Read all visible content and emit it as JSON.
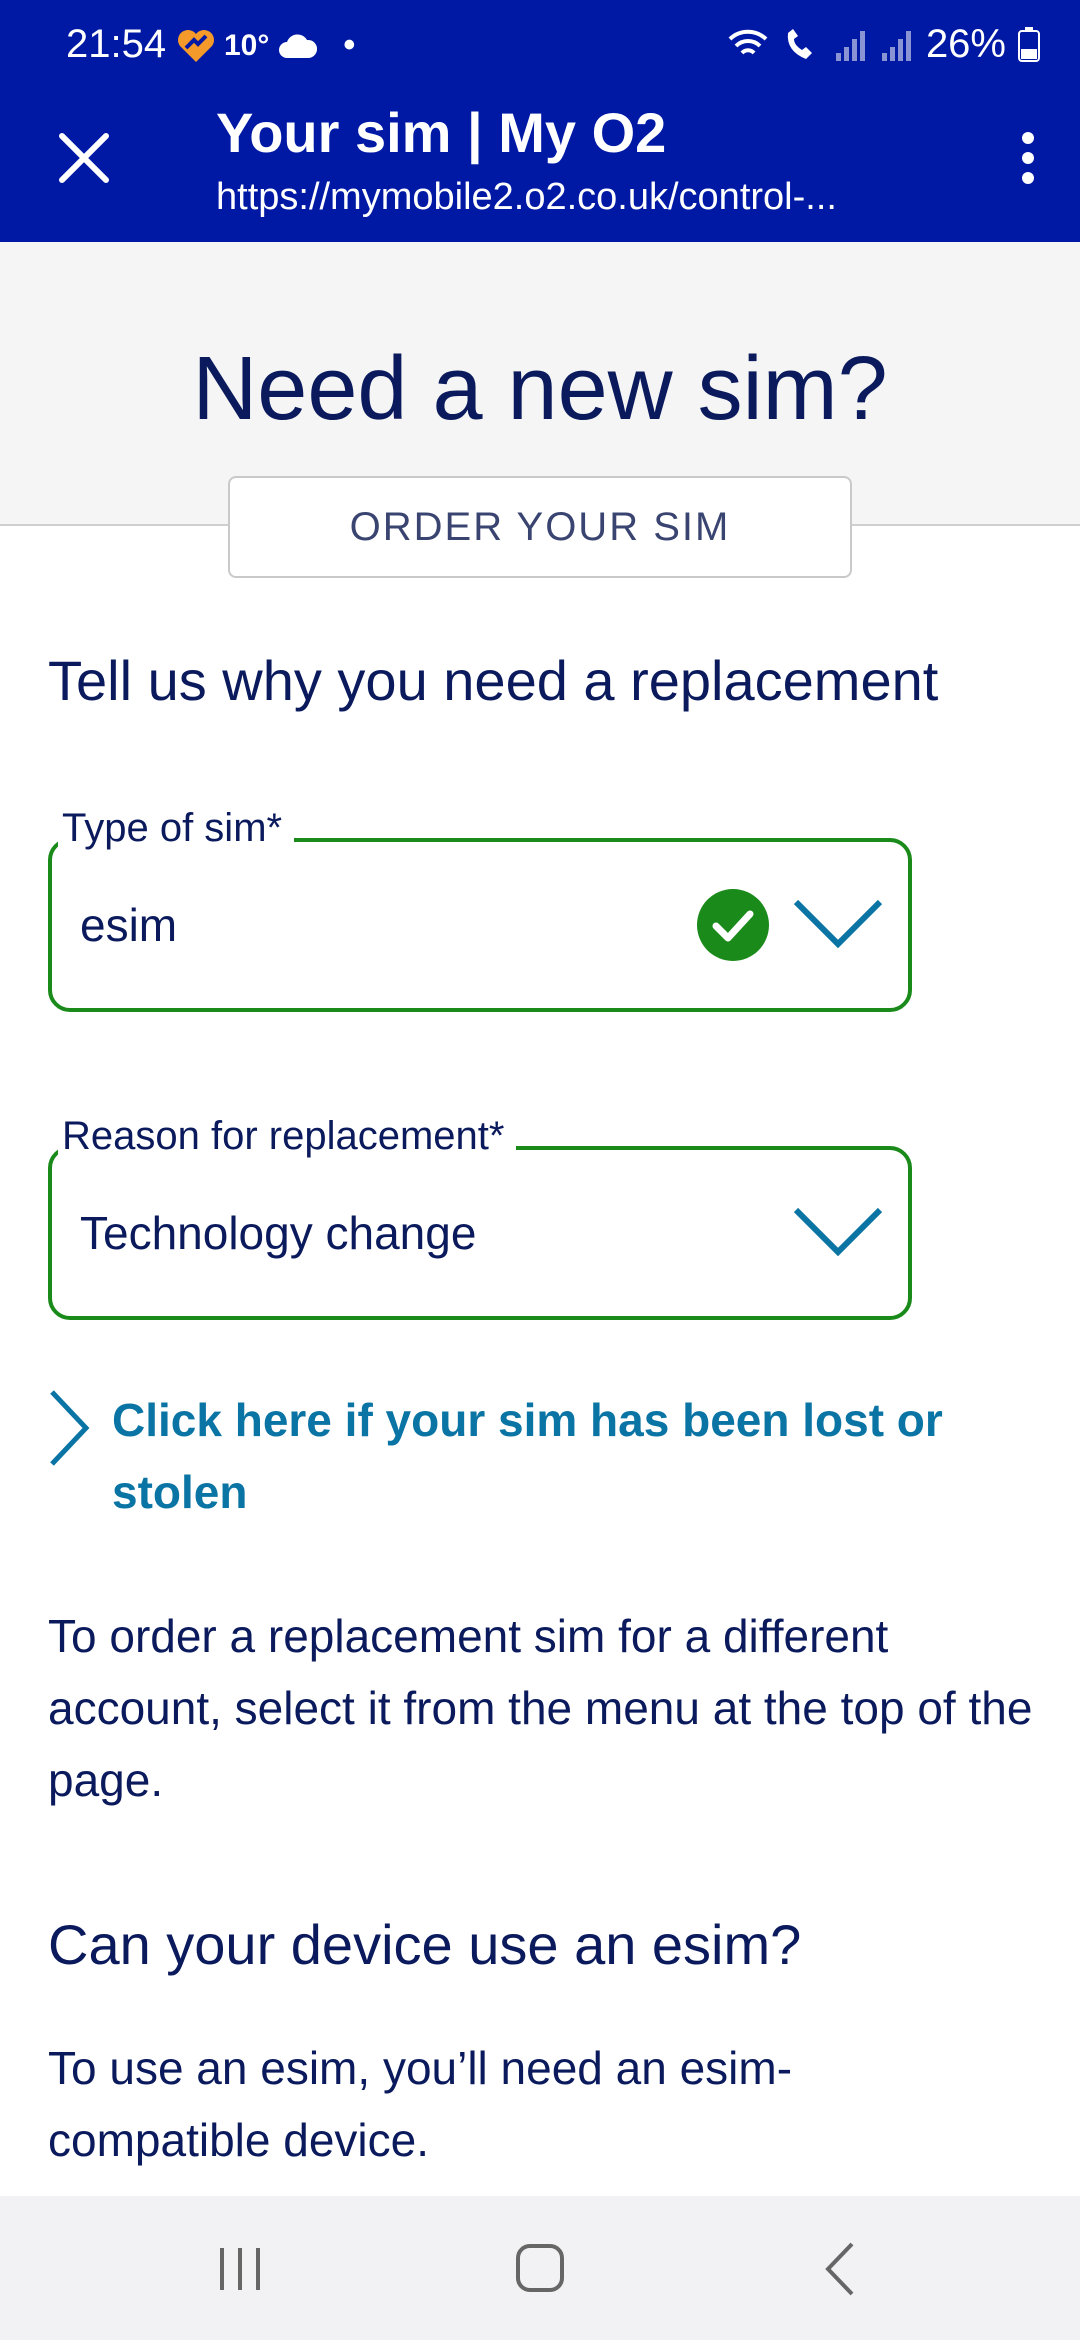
{
  "status_bar": {
    "time": "21:54",
    "temperature": "10°",
    "dot": "•",
    "battery": "26%",
    "icons": [
      "heart-notification-icon",
      "cloud-icon",
      "wifi-icon",
      "wifi-call-icon",
      "signal-icon",
      "signal-icon",
      "battery-icon"
    ]
  },
  "browser": {
    "title": "Your sim | My O2",
    "url": "https://mymobile2.o2.co.uk/control-..."
  },
  "hero": {
    "title": "Need a new sim?",
    "order_button": "ORDER YOUR SIM"
  },
  "form": {
    "heading": "Tell us why you need a replacement",
    "type_of_sim": {
      "label": "Type of sim*",
      "value": "esim",
      "valid": true
    },
    "reason": {
      "label": "Reason for replacement*",
      "value": "Technology change"
    }
  },
  "lost_link": "Click here if your sim has been lost or stolen",
  "info_text": "To order a replacement sim for a different account, select it from the menu at the top of the page.",
  "esim": {
    "heading": "Can your device use an esim?",
    "text": "To use an esim, you’ll need an esim-compatible device."
  },
  "colors": {
    "brand": "#0019a5",
    "text": "#0a1a5c",
    "valid_border": "#1a8a1a",
    "link": "#0a74a4"
  }
}
